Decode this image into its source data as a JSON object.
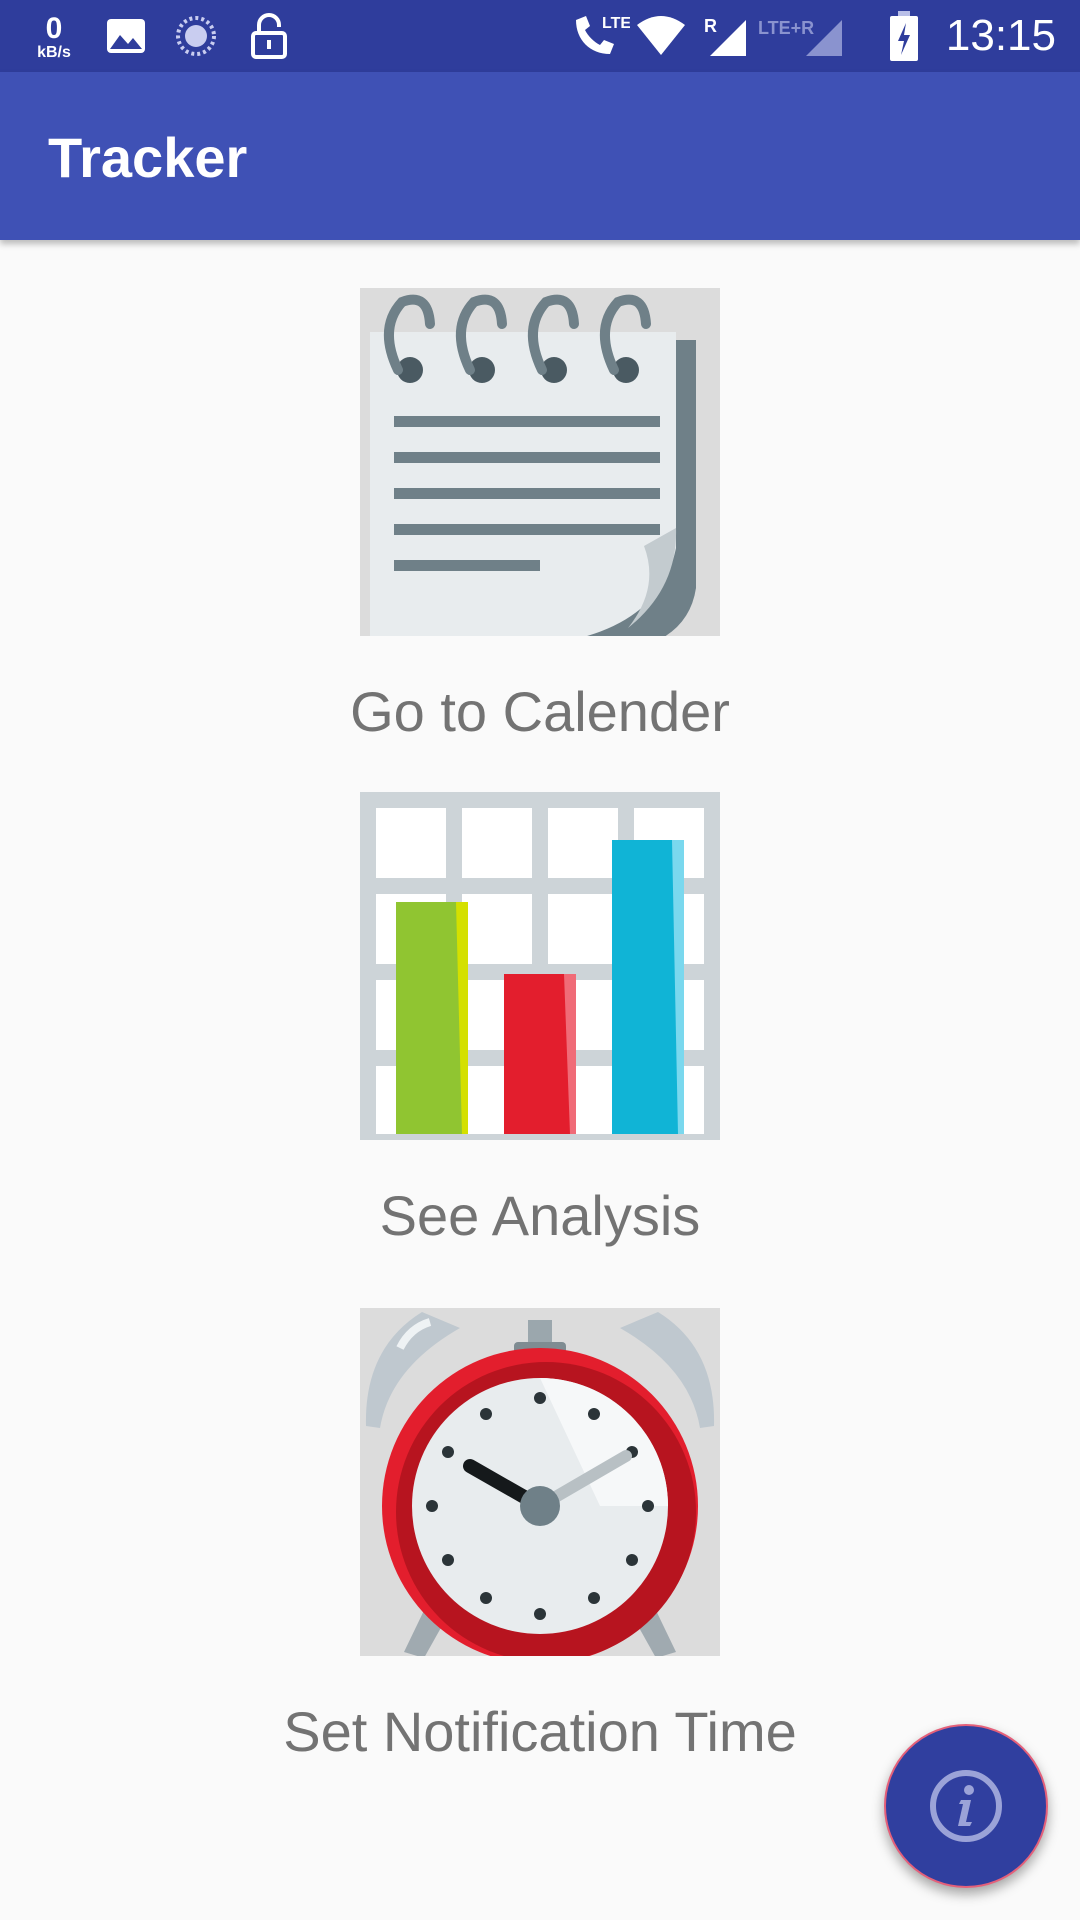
{
  "status_bar": {
    "speed_value": "0",
    "speed_unit": "kB/s",
    "network_lte": "LTE",
    "roaming": "R",
    "network_lte_r": "LTE+R",
    "time": "13:15"
  },
  "app_bar": {
    "title": "Tracker"
  },
  "menu": {
    "items": [
      {
        "label": "Go to Calender",
        "icon": "notepad-icon"
      },
      {
        "label": "See Analysis",
        "icon": "bar-chart-icon"
      },
      {
        "label": "Set Notification Time",
        "icon": "alarm-clock-icon"
      }
    ]
  },
  "fab": {
    "icon": "info-icon"
  },
  "colors": {
    "status_bar": "#2f3d9c",
    "app_bar": "#3f51b5",
    "fab": "#303f9f",
    "label_text": "#737373",
    "background": "#fafafa"
  }
}
